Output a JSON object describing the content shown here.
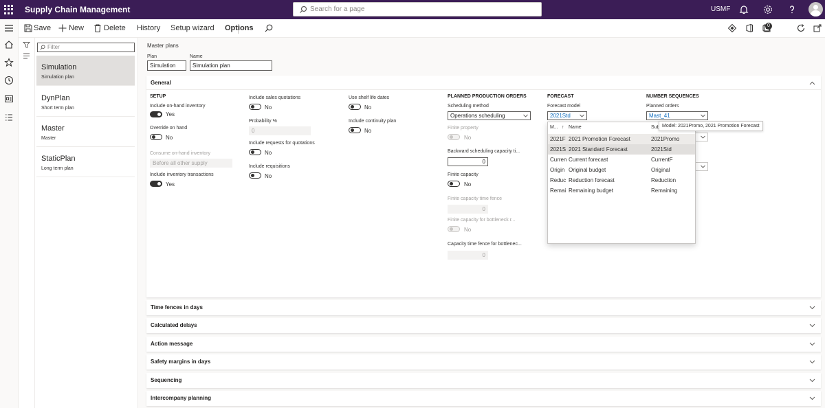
{
  "app": {
    "title": "Supply Chain Management",
    "company": "USMF"
  },
  "search": {
    "placeholder": "Search for a page"
  },
  "toolbar": {
    "save": "Save",
    "new": "New",
    "delete": "Delete",
    "history": "History",
    "setup_wizard": "Setup wizard",
    "options": "Options",
    "badge": "0"
  },
  "list": {
    "filter_placeholder": "Filter",
    "items": [
      {
        "name": "Simulation",
        "desc": "Simulation plan"
      },
      {
        "name": "DynPlan",
        "desc": "Short term plan"
      },
      {
        "name": "Master",
        "desc": "Master"
      },
      {
        "name": "StaticPlan",
        "desc": "Long term plan"
      }
    ]
  },
  "header": {
    "breadcrumb": "Master plans",
    "plan_label": "Plan",
    "plan_value": "Simulation",
    "name_label": "Name",
    "name_value": "Simulation plan"
  },
  "general": {
    "title": "General",
    "setup": {
      "heading": "SETUP",
      "onhand_label": "Include on-hand inventory",
      "onhand_value": "Yes",
      "override_label": "Override on hand",
      "override_value": "No",
      "consume_label": "Consume on-hand inventory",
      "consume_value": "Before all other supply",
      "invtrans_label": "Include inventory transactions",
      "invtrans_value": "Yes"
    },
    "col2": {
      "salesq_label": "Include sales quotations",
      "salesq_value": "No",
      "prob_label": "Probability %",
      "prob_value": "0",
      "rfq_label": "Include requests for quotations",
      "rfq_value": "No",
      "req_label": "Include requisitions",
      "req_value": "No"
    },
    "col3": {
      "shelf_label": "Use shelf life dates",
      "shelf_value": "No",
      "cont_label": "Include continuity plan",
      "cont_value": "No"
    },
    "production": {
      "heading": "PLANNED PRODUCTION ORDERS",
      "sched_label": "Scheduling method",
      "sched_value": "Operations scheduling",
      "finprop_label": "Finite property",
      "finprop_value": "No",
      "backward_label": "Backward scheduling capacity ti...",
      "backward_value": "0",
      "fincap_label": "Finite capacity",
      "fincap_value": "No",
      "fincaptf_label": "Finite capacity time fence",
      "fincaptf_value": "0",
      "finbottle_label": "Finite capacity for bottleneck r...",
      "finbottle_value": "No",
      "captf_label": "Capacity time fence for bottlenec...",
      "captf_value": "0"
    },
    "forecast": {
      "heading": "FORECAST",
      "model_label": "Forecast model",
      "model_value": "2021Std"
    },
    "numseq": {
      "heading": "NUMBER SEQUENCES",
      "planned_label": "Planned orders",
      "planned_value": "Mast_41"
    }
  },
  "dropdown": {
    "col_model": "M...",
    "col_name": "Name",
    "col_sub": "Sub",
    "rows": [
      {
        "model": "2021F",
        "name": "2021 Promotion Forecast",
        "sub": "2021Promo"
      },
      {
        "model": "2021S",
        "name": "2021 Standard Forecast",
        "sub": "2021Std"
      },
      {
        "model": "Curren",
        "name": "Current forecast",
        "sub": "CurrentF"
      },
      {
        "model": "Origin",
        "name": "Original budget",
        "sub": "Original"
      },
      {
        "model": "Reduc",
        "name": "Reduction forecast",
        "sub": "Reduction"
      },
      {
        "model": "Remai",
        "name": "Remaining budget",
        "sub": "Remaining"
      }
    ]
  },
  "tooltip": "Model: 2021Promo, 2021 Promotion Forecast",
  "sections": [
    "Time fences in days",
    "Calculated delays",
    "Action message",
    "Safety margins in days",
    "Sequencing",
    "Intercompany planning"
  ]
}
